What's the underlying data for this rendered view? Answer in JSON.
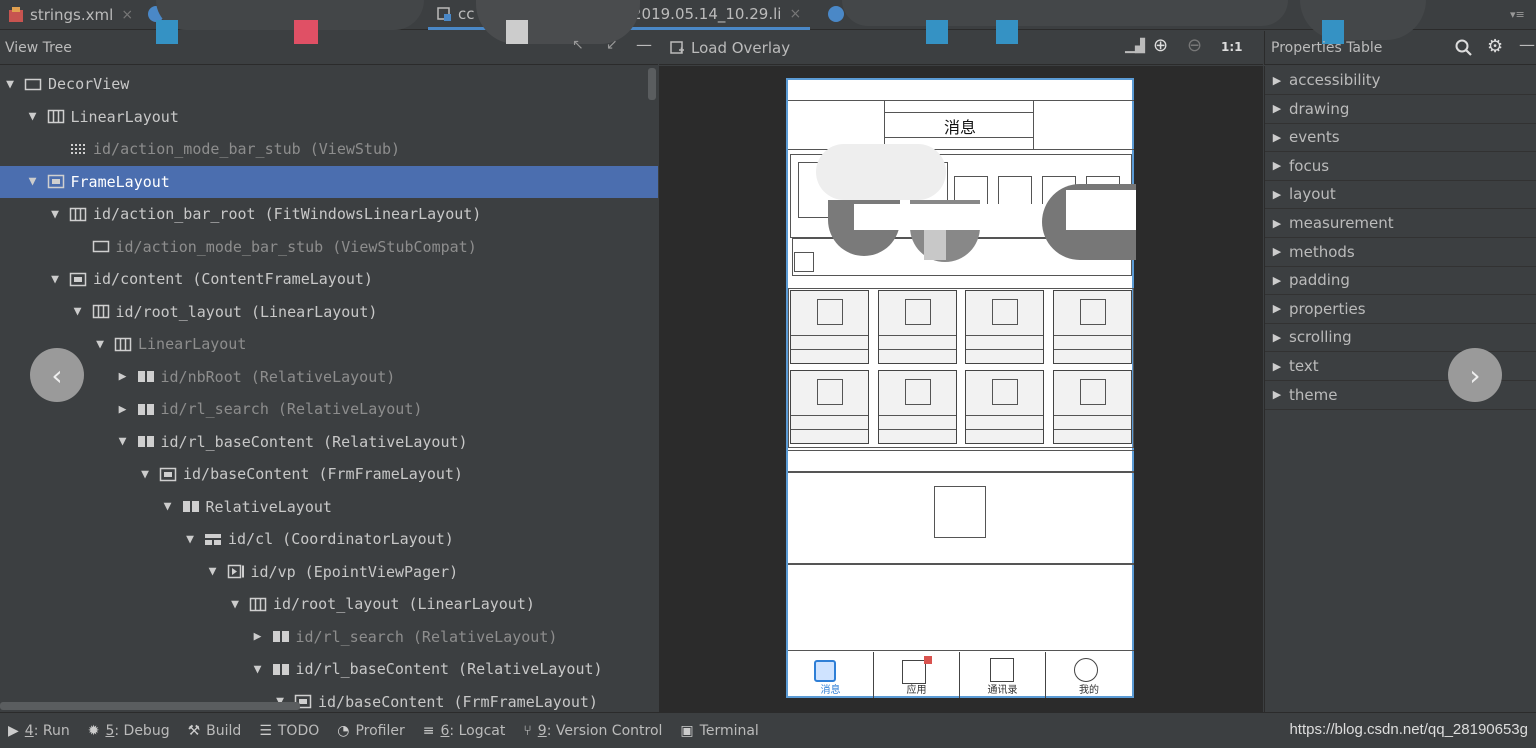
{
  "tabs": [
    {
      "label": "strings.xml",
      "close": "×"
    },
    {
      "label": "cc",
      "close": ""
    },
    {
      "label": "_2019.05.14_10.29.li",
      "close": "×"
    }
  ],
  "view_tree": {
    "title": "View Tree",
    "rows": [
      {
        "label": "DecorView",
        "arrow": "▼",
        "icon": "window-icon"
      },
      {
        "label": "LinearLayout",
        "arrow": "▼",
        "icon": "columns-icon"
      },
      {
        "label": "id/action_mode_bar_stub (ViewStub)",
        "arrow": "",
        "icon": "stub-icon"
      },
      {
        "label": "FrameLayout",
        "arrow": "▼",
        "icon": "frame-icon"
      },
      {
        "label": "id/action_bar_root (FitWindowsLinearLayout)",
        "arrow": "▼",
        "icon": "columns-icon"
      },
      {
        "label": "id/action_mode_bar_stub (ViewStubCompat)",
        "arrow": "",
        "icon": "window-icon"
      },
      {
        "label": "id/content (ContentFrameLayout)",
        "arrow": "▼",
        "icon": "frame-icon"
      },
      {
        "label": "id/root_layout (LinearLayout)",
        "arrow": "▼",
        "icon": "columns-icon"
      },
      {
        "label": "LinearLayout",
        "arrow": "▼",
        "icon": "columns-icon"
      },
      {
        "label": "id/nbRoot (RelativeLayout)",
        "arrow": "▶",
        "icon": "relative-icon"
      },
      {
        "label": "id/rl_search (RelativeLayout)",
        "arrow": "▶",
        "icon": "relative-icon"
      },
      {
        "label": "id/rl_baseContent (RelativeLayout)",
        "arrow": "▼",
        "icon": "relative-icon"
      },
      {
        "label": "id/baseContent (FrmFrameLayout)",
        "arrow": "▼",
        "icon": "frame-icon"
      },
      {
        "label": "RelativeLayout",
        "arrow": "▼",
        "icon": "relative-icon"
      },
      {
        "label": "id/cl (CoordinatorLayout)",
        "arrow": "▼",
        "icon": "coordinator-icon"
      },
      {
        "label": "id/vp (EpointViewPager)",
        "arrow": "▼",
        "icon": "pager-icon"
      },
      {
        "label": "id/root_layout (LinearLayout)",
        "arrow": "▼",
        "icon": "columns-icon"
      },
      {
        "label": "id/rl_search (RelativeLayout)",
        "arrow": "▶",
        "icon": "relative-icon"
      },
      {
        "label": "id/rl_baseContent (RelativeLayout)",
        "arrow": "▼",
        "icon": "relative-icon"
      },
      {
        "label": "id/baseContent (FrmFrameLayout)",
        "arrow": "▼",
        "icon": "frame-icon"
      }
    ]
  },
  "preview": {
    "load_overlay": "Load Overlay",
    "zoom_reset": "1:1",
    "phone_title": "消息",
    "nav": [
      {
        "label": "消息"
      },
      {
        "label": "应用"
      },
      {
        "label": "通讯录"
      },
      {
        "label": "我的"
      }
    ]
  },
  "properties": {
    "title": "Properties Table",
    "items": [
      "accessibility",
      "drawing",
      "events",
      "focus",
      "layout",
      "measurement",
      "methods",
      "padding",
      "properties",
      "scrolling",
      "text",
      "theme"
    ]
  },
  "status_bar": {
    "tools": [
      {
        "num": "4",
        "label": ": Run",
        "icon": "run-icon"
      },
      {
        "num": "5",
        "label": ": Debug",
        "icon": "debug-icon"
      },
      {
        "num": "",
        "label": "Build",
        "icon": "build-icon"
      },
      {
        "num": "",
        "label": "TODO",
        "icon": "todo-icon"
      },
      {
        "num": "",
        "label": "Profiler",
        "icon": "profiler-icon"
      },
      {
        "num": "6",
        "label": ": Logcat",
        "icon": "logcat-icon"
      },
      {
        "num": "9",
        "label": ": Version Control",
        "icon": "vcs-icon"
      },
      {
        "num": "",
        "label": "Terminal",
        "icon": "terminal-icon"
      }
    ],
    "url": "https://blog.csdn.net/qq_28190653g"
  },
  "colors": {
    "selection": "#4b6eaf",
    "tab_accent": "#4a88c7",
    "preview_border": "#5b9bd5"
  }
}
